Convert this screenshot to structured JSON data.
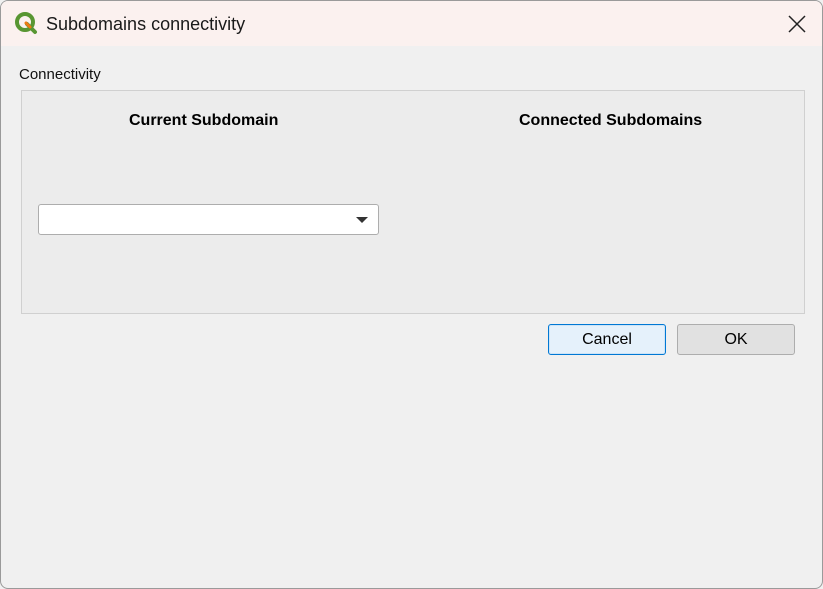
{
  "window": {
    "title": "Subdomains connectivity"
  },
  "icons": {
    "app": "qgis-logo-icon",
    "close": "close-icon",
    "dropdown": "chevron-down-icon"
  },
  "connectivity": {
    "group_label": "Connectivity",
    "current_header": "Current Subdomain",
    "connected_header": "Connected Subdomains",
    "current_value": ""
  },
  "buttons": {
    "cancel_label": "Cancel",
    "ok_label": "OK"
  },
  "colors": {
    "accent": "#0078d4",
    "qgis_green": "#589632",
    "qgis_yellow": "#ee7913"
  }
}
